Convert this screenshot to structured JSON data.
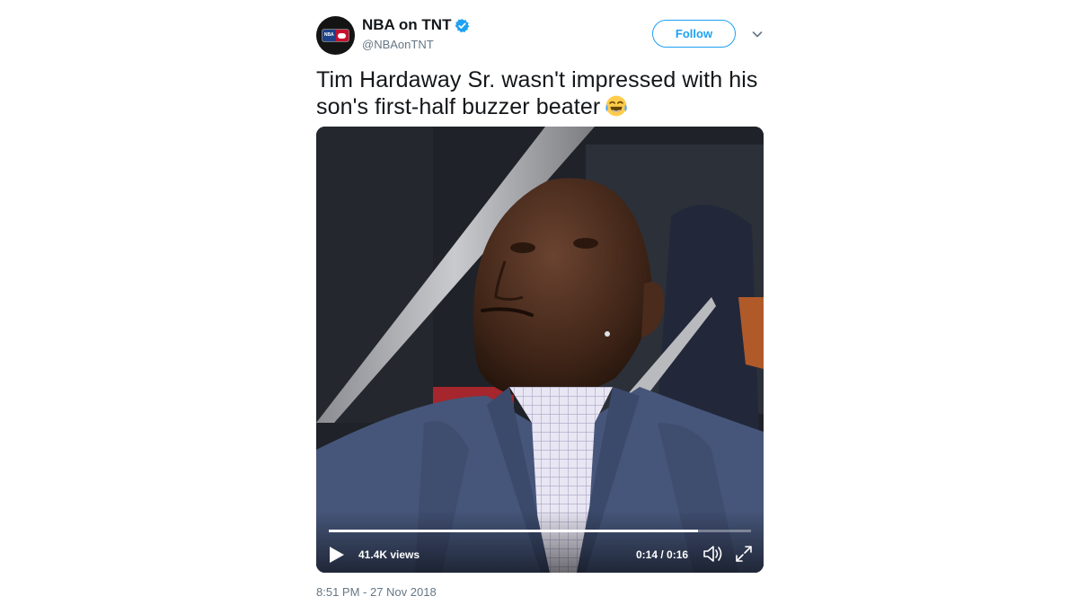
{
  "tweet": {
    "display_name": "NBA on TNT",
    "handle": "@NBAonTNT",
    "verified": true,
    "follow_label": "Follow",
    "text": "Tim Hardaway Sr. wasn't impressed with his son's first-half buzzer beater",
    "emoji": "face-with-tears-of-joy",
    "timestamp": "8:51 PM - 27 Nov 2018"
  },
  "video": {
    "views": "41.4K views",
    "time": "0:14 / 0:16",
    "progress": 0.875
  },
  "colors": {
    "accent": "#1da1f2",
    "text": "#14171a",
    "muted": "#657786"
  }
}
